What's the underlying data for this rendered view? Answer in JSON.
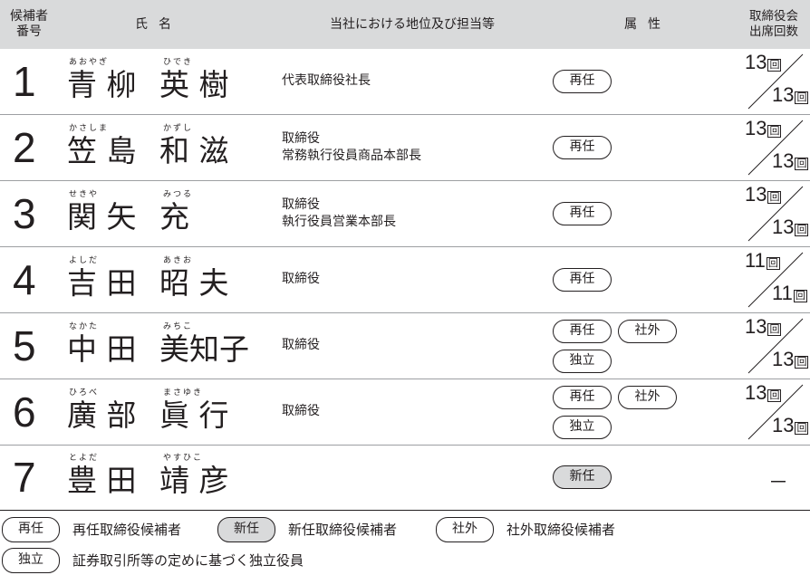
{
  "header": {
    "no": "候補者\n番号",
    "name": "氏名",
    "position": "当社における地位及び担当等",
    "attribute": "属性",
    "attendance": "取締役会\n出席回数"
  },
  "kai": "回",
  "candidates": [
    {
      "no": "1",
      "family": "青 柳",
      "given": "英 樹",
      "family_ruby": "あおやぎ",
      "given_ruby": "ひでき",
      "position": [
        "代表取締役社長"
      ],
      "badges": [
        "再任"
      ],
      "att_top": "13",
      "att_bot": "13"
    },
    {
      "no": "2",
      "family": "笠 島",
      "given": "和 滋",
      "family_ruby": "かさしま",
      "given_ruby": "かずし",
      "position": [
        "取締役",
        "常務執行役員商品本部長"
      ],
      "badges": [
        "再任"
      ],
      "att_top": "13",
      "att_bot": "13"
    },
    {
      "no": "3",
      "family": "関 矢",
      "given": "充",
      "family_ruby": "せきや",
      "given_ruby": "みつる",
      "position": [
        "取締役",
        "執行役員営業本部長"
      ],
      "badges": [
        "再任"
      ],
      "att_top": "13",
      "att_bot": "13"
    },
    {
      "no": "4",
      "family": "吉 田",
      "given": "昭 夫",
      "family_ruby": "よしだ",
      "given_ruby": "あきお",
      "position": [
        "取締役"
      ],
      "badges": [
        "再任"
      ],
      "att_top": "11",
      "att_bot": "11"
    },
    {
      "no": "5",
      "family": "中 田",
      "given": "美知子",
      "family_ruby": "なかた",
      "given_ruby": "みちこ",
      "position": [
        "取締役"
      ],
      "badges": [
        "再任",
        "社外",
        "独立"
      ],
      "att_top": "13",
      "att_bot": "13"
    },
    {
      "no": "6",
      "family": "廣 部",
      "given": "眞 行",
      "family_ruby": "ひろべ",
      "given_ruby": "まさゆき",
      "position": [
        "取締役"
      ],
      "badges": [
        "再任",
        "社外",
        "独立"
      ],
      "att_top": "13",
      "att_bot": "13"
    },
    {
      "no": "7",
      "family": "豊 田",
      "given": "靖 彦",
      "family_ruby": "とよだ",
      "given_ruby": "やすひこ",
      "position": [],
      "badges": [
        "新任"
      ],
      "att_top": "",
      "att_bot": "",
      "att_none": "－"
    }
  ],
  "legend": {
    "reelect_badge": "再任",
    "reelect_text": "再任取締役候補者",
    "new_badge": "新任",
    "new_text": "新任取締役候補者",
    "outside_badge": "社外",
    "outside_text": "社外取締役候補者",
    "independent_badge": "独立",
    "independent_text": "証券取引所等の定めに基づく独立役員"
  }
}
